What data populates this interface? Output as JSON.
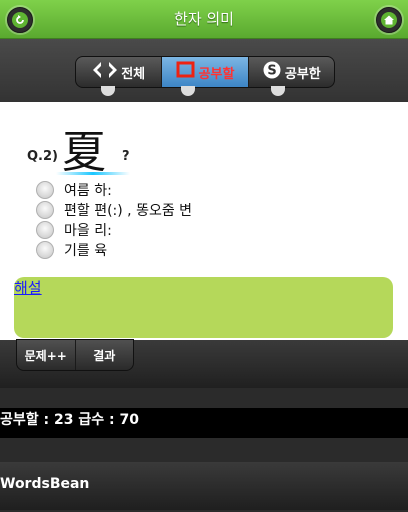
{
  "header": {
    "title": "한자 의미",
    "back_icon": "back-arrow-icon",
    "home_icon": "home-icon"
  },
  "tabs": [
    {
      "label": "전체",
      "icon": "diamond-icon",
      "active": false
    },
    {
      "label": "공부할",
      "icon": "square-icon",
      "active": true
    },
    {
      "label": "공부한",
      "icon": "s-icon",
      "active": false
    }
  ],
  "question": {
    "number": "Q.2)",
    "hanja": "夏",
    "mark": "?",
    "options": [
      "여름 하:",
      "편할 편(:) , 똥오줌 변",
      "마을 리:",
      "기를 육"
    ]
  },
  "explanation": {
    "link": "해설"
  },
  "footer": {
    "next_button": "문제++",
    "result_button": "결과"
  },
  "stats": {
    "text": "공부할 : 23 급수 : 70"
  },
  "brand": "WordsBean",
  "colors": {
    "header_green": "#5aa92f",
    "active_tab": "#3d85c6",
    "explanation_box": "#b5d85a"
  }
}
